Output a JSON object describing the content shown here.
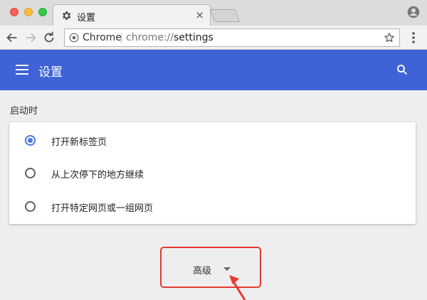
{
  "tab": {
    "title": "设置",
    "close": "×"
  },
  "omnibox": {
    "chip": "Chrome",
    "url_scheme": "chrome://",
    "url_path": "settings"
  },
  "header": {
    "title": "设置"
  },
  "startup": {
    "title": "启动时",
    "options": [
      {
        "label": "打开新标签页",
        "checked": true
      },
      {
        "label": "从上次停下的地方继续",
        "checked": false
      },
      {
        "label": "打开特定网页或一组网页",
        "checked": false
      }
    ]
  },
  "advanced": {
    "label": "高级"
  },
  "colors": {
    "header": "#3f63d6",
    "radio_checked": "#4a78e0",
    "highlight": "#e53935"
  },
  "icons": [
    "gear-icon",
    "back-icon",
    "forward-icon",
    "reload-icon",
    "star-icon",
    "menu-icon",
    "search-icon",
    "profile-icon",
    "chevron-down-icon"
  ]
}
